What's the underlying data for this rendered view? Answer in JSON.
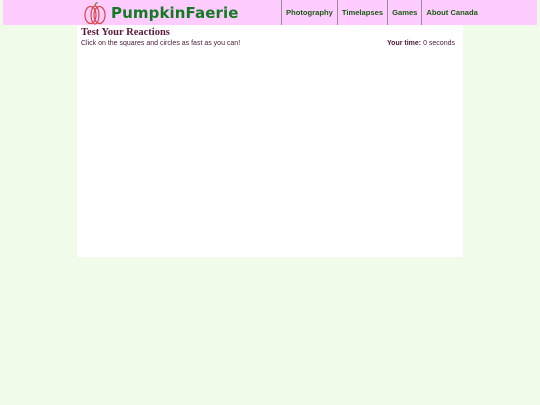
{
  "brand": {
    "name": "PumpkinFaerie",
    "logo_icon": "pumpkin-icon",
    "color": "#117a22"
  },
  "nav": {
    "items": [
      {
        "label": "Photography"
      },
      {
        "label": "Timelapses"
      },
      {
        "label": "Games"
      },
      {
        "label": "About Canada"
      }
    ]
  },
  "main": {
    "title": "Test Your Reactions",
    "instructions": "Click on the squares and circles as fast as you can!",
    "timer_label": "Your time:",
    "timer_value": "0 seconds"
  },
  "colors": {
    "header_bg": "#ffccff",
    "page_bg": "#f1fbea",
    "panel_bg": "#ffffff",
    "accent": "#e05050"
  }
}
